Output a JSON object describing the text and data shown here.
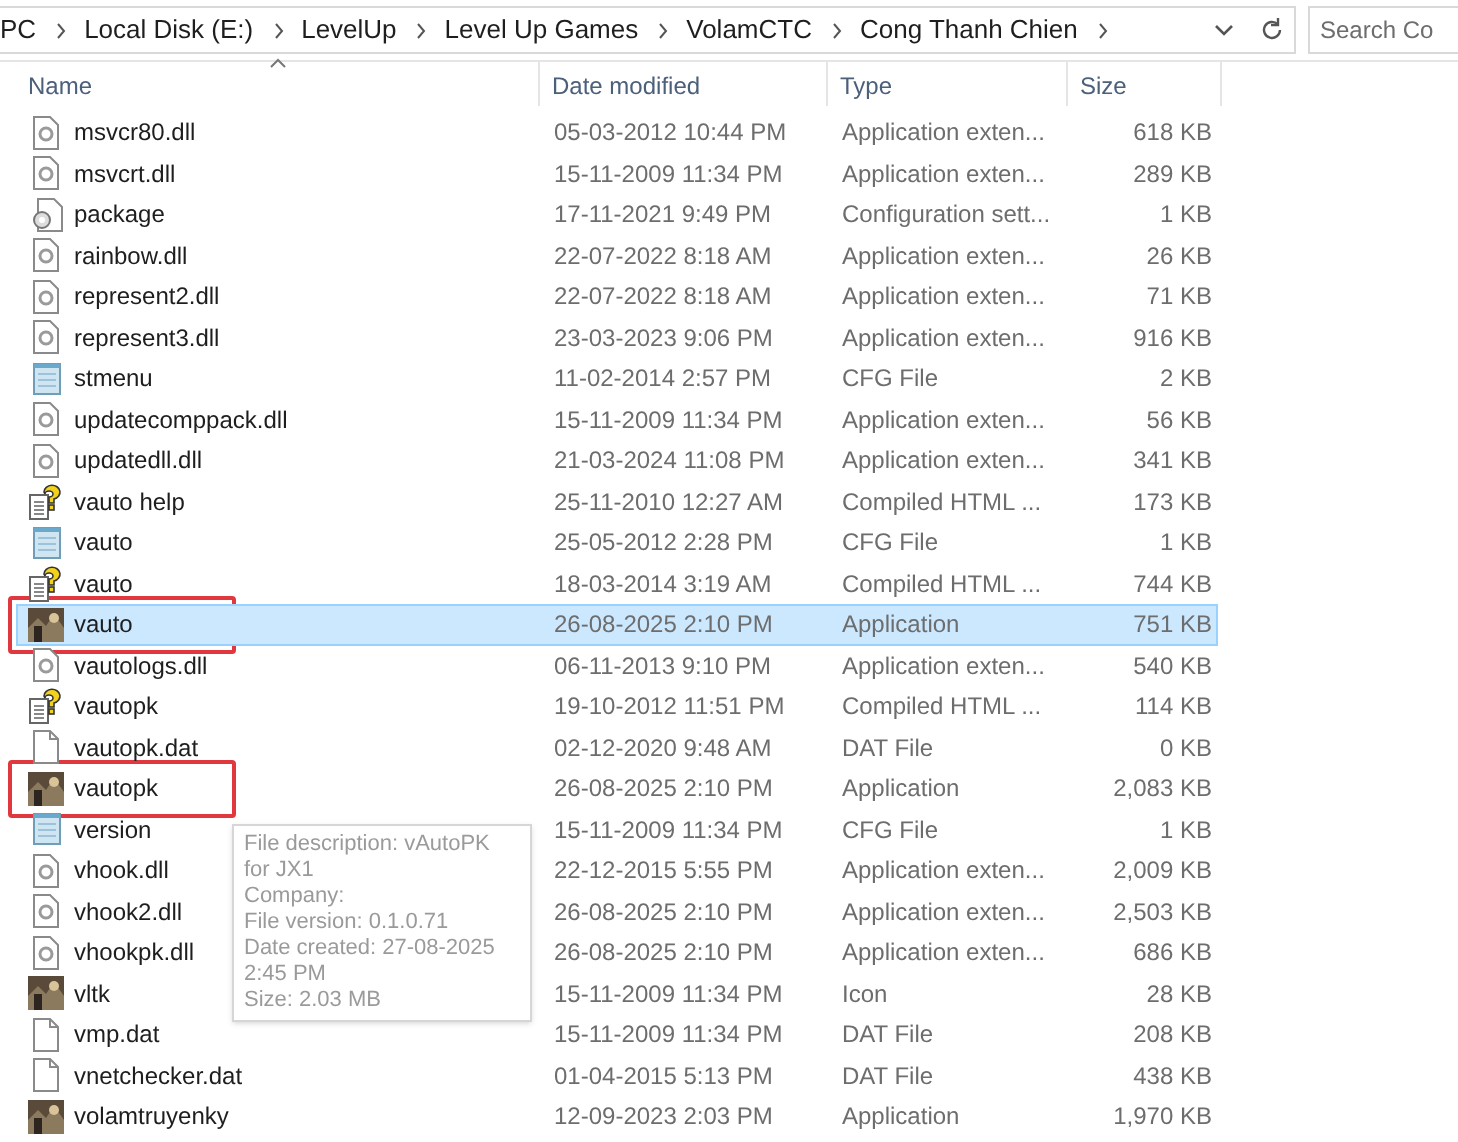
{
  "address_bar": {
    "crumbs": [
      "PC",
      "Local Disk (E:)",
      "LevelUp",
      "Level Up Games",
      "VolamCTC",
      "Cong Thanh Chien"
    ]
  },
  "search": {
    "placeholder": "Search Co"
  },
  "columns": [
    {
      "label": "Name",
      "sorted": true
    },
    {
      "label": "Date modified",
      "sorted": false
    },
    {
      "label": "Type",
      "sorted": false
    },
    {
      "label": "Size",
      "sorted": false
    }
  ],
  "rows": [
    {
      "name": "msvcr80.dll",
      "date": "05-03-2012 10:44 PM",
      "type": "Application exten...",
      "size": "618 KB",
      "kind": "dll",
      "selected": false,
      "marked": false
    },
    {
      "name": "msvcrt.dll",
      "date": "15-11-2009 11:34 PM",
      "type": "Application exten...",
      "size": "289 KB",
      "kind": "dll",
      "selected": false,
      "marked": false
    },
    {
      "name": "package",
      "date": "17-11-2021 9:49 PM",
      "type": "Configuration sett...",
      "size": "1 KB",
      "kind": "config",
      "selected": false,
      "marked": false
    },
    {
      "name": "rainbow.dll",
      "date": "22-07-2022 8:18 AM",
      "type": "Application exten...",
      "size": "26 KB",
      "kind": "dll",
      "selected": false,
      "marked": false
    },
    {
      "name": "represent2.dll",
      "date": "22-07-2022 8:18 AM",
      "type": "Application exten...",
      "size": "71 KB",
      "kind": "dll",
      "selected": false,
      "marked": false
    },
    {
      "name": "represent3.dll",
      "date": "23-03-2023 9:06 PM",
      "type": "Application exten...",
      "size": "916 KB",
      "kind": "dll",
      "selected": false,
      "marked": false
    },
    {
      "name": "stmenu",
      "date": "11-02-2014 2:57 PM",
      "type": "CFG File",
      "size": "2 KB",
      "kind": "cfg",
      "selected": false,
      "marked": false
    },
    {
      "name": "updatecomppack.dll",
      "date": "15-11-2009 11:34 PM",
      "type": "Application exten...",
      "size": "56 KB",
      "kind": "dll",
      "selected": false,
      "marked": false
    },
    {
      "name": "updatedll.dll",
      "date": "21-03-2024 11:08 PM",
      "type": "Application exten...",
      "size": "341 KB",
      "kind": "dll",
      "selected": false,
      "marked": false
    },
    {
      "name": "vauto help",
      "date": "25-11-2010 12:27 AM",
      "type": "Compiled HTML ...",
      "size": "173 KB",
      "kind": "help",
      "selected": false,
      "marked": false
    },
    {
      "name": "vauto",
      "date": "25-05-2012 2:28 PM",
      "type": "CFG File",
      "size": "1 KB",
      "kind": "cfg",
      "selected": false,
      "marked": false
    },
    {
      "name": "vauto",
      "date": "18-03-2014 3:19 AM",
      "type": "Compiled HTML ...",
      "size": "744 KB",
      "kind": "help",
      "selected": false,
      "marked": false
    },
    {
      "name": "vauto",
      "date": "26-08-2025 2:10 PM",
      "type": "Application",
      "size": "751 KB",
      "kind": "app",
      "selected": true,
      "marked": true
    },
    {
      "name": "vautologs.dll",
      "date": "06-11-2013 9:10 PM",
      "type": "Application exten...",
      "size": "540 KB",
      "kind": "dll",
      "selected": false,
      "marked": false
    },
    {
      "name": "vautopk",
      "date": "19-10-2012 11:51 PM",
      "type": "Compiled HTML ...",
      "size": "114 KB",
      "kind": "help",
      "selected": false,
      "marked": false
    },
    {
      "name": "vautopk.dat",
      "date": "02-12-2020 9:48 AM",
      "type": "DAT File",
      "size": "0 KB",
      "kind": "dat",
      "selected": false,
      "marked": false
    },
    {
      "name": "vautopk",
      "date": "26-08-2025 2:10 PM",
      "type": "Application",
      "size": "2,083 KB",
      "kind": "app",
      "selected": false,
      "marked": true
    },
    {
      "name": "version",
      "date": "15-11-2009 11:34 PM",
      "type": "CFG File",
      "size": "1 KB",
      "kind": "cfg",
      "selected": false,
      "marked": false
    },
    {
      "name": "vhook.dll",
      "date": "22-12-2015 5:55 PM",
      "type": "Application exten...",
      "size": "2,009 KB",
      "kind": "dll",
      "selected": false,
      "marked": false
    },
    {
      "name": "vhook2.dll",
      "date": "26-08-2025 2:10 PM",
      "type": "Application exten...",
      "size": "2,503 KB",
      "kind": "dll",
      "selected": false,
      "marked": false
    },
    {
      "name": "vhookpk.dll",
      "date": "26-08-2025 2:10 PM",
      "type": "Application exten...",
      "size": "686 KB",
      "kind": "dll",
      "selected": false,
      "marked": false
    },
    {
      "name": "vltk",
      "date": "15-11-2009 11:34 PM",
      "type": "Icon",
      "size": "28 KB",
      "kind": "ico",
      "selected": false,
      "marked": false
    },
    {
      "name": "vmp.dat",
      "date": "15-11-2009 11:34 PM",
      "type": "DAT File",
      "size": "208 KB",
      "kind": "dat",
      "selected": false,
      "marked": false
    },
    {
      "name": "vnetchecker.dat",
      "date": "01-04-2015 5:13 PM",
      "type": "DAT File",
      "size": "438 KB",
      "kind": "dat",
      "selected": false,
      "marked": false
    },
    {
      "name": "volamtruyenky",
      "date": "12-09-2023 2:03 PM",
      "type": "Application",
      "size": "1,970 KB",
      "kind": "app",
      "selected": false,
      "marked": false
    }
  ],
  "tooltip": {
    "lines": [
      "File description: vAutoPK for JX1",
      "Company:",
      "File version: 0.1.0.71",
      "Date created: 27-08-2025 2:45 PM",
      "Size: 2.03 MB"
    ]
  }
}
